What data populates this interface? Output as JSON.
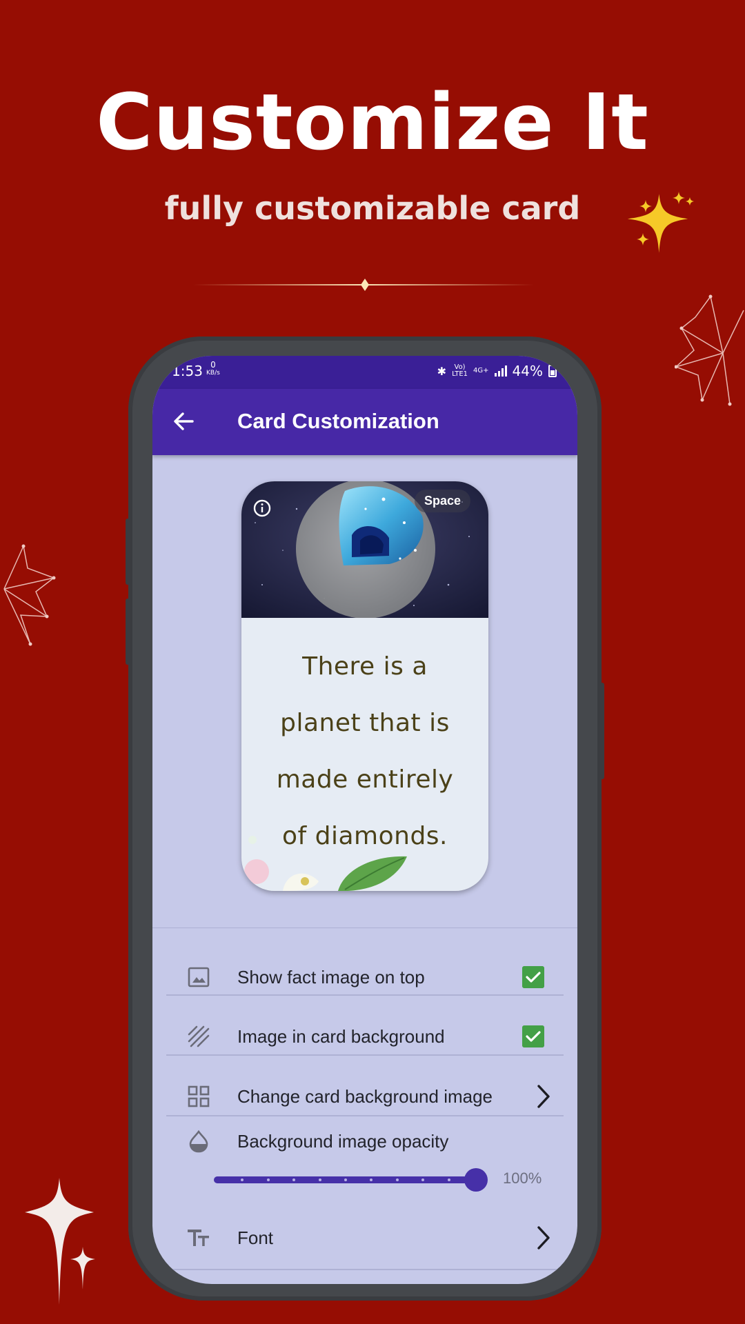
{
  "promo": {
    "headline": "Customize It",
    "subheadline": "fully customizable card"
  },
  "status_bar": {
    "time": "1:53",
    "speed_value": "0",
    "speed_unit": "KB/s",
    "network_volte": "Vo)",
    "network_lte": "LTE1",
    "network_4g": "4G+",
    "battery": "44%"
  },
  "app_bar": {
    "title": "Card Customization"
  },
  "card_preview": {
    "category": "Space",
    "fact_lines": [
      "There is a",
      "planet that is",
      "made entirely",
      "of diamonds."
    ]
  },
  "settings": {
    "show_fact_image": {
      "label": "Show fact image on top",
      "checked": true
    },
    "image_in_background": {
      "label": "Image in card background",
      "checked": true
    },
    "change_background": {
      "label": "Change card background image"
    },
    "opacity": {
      "label": "Background image opacity",
      "value": 1.0,
      "value_label": "100%"
    },
    "font": {
      "label": "Font"
    }
  },
  "colors": {
    "page_background": "#960d03",
    "status_bar": "#3a1f96",
    "app_bar": "#4728a6",
    "screen_background": "#c6c9e9",
    "checkbox": "#43a047",
    "slider": "#4630a8",
    "sparkle_gold": "#f6c928"
  },
  "icons": {
    "back": "arrow-left-icon",
    "info": "info-circle-icon",
    "image": "image-icon",
    "pattern": "diagonal-lines-icon",
    "grid": "grid-icon",
    "opacity": "drop-icon",
    "font": "text-size-icon",
    "chevron": "chevron-right-icon",
    "check": "check-icon"
  }
}
